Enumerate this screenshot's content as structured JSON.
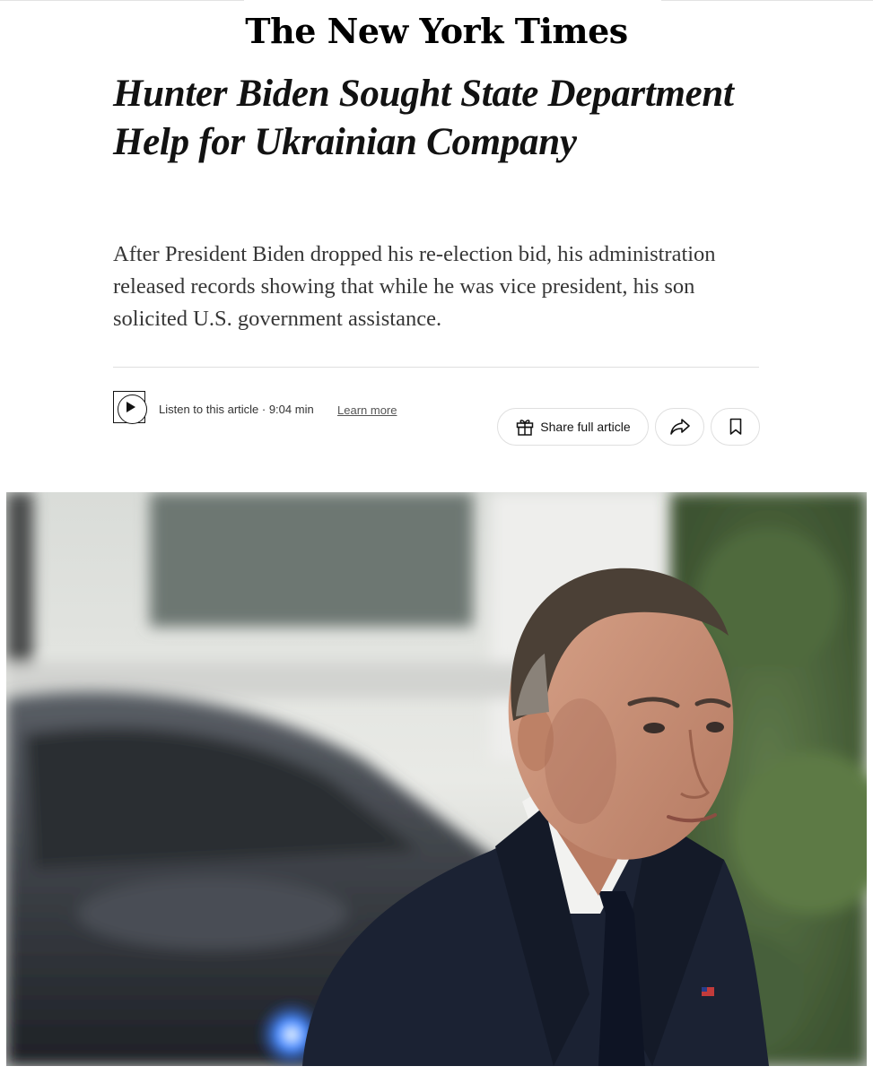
{
  "masthead": {
    "logo_text": "The New York Times"
  },
  "article": {
    "headline": "Hunter Biden Sought State Department Help for Ukrainian Company",
    "summary": "After President Biden dropped his re-election bid, his administration released records showing that while he was vice president, his son solicited U.S. government assistance."
  },
  "audio": {
    "label": "Listen to this article · 9:04 min",
    "learn_more": "Learn more",
    "icon": "play-icon"
  },
  "actions": {
    "share_full_label": "Share full article",
    "gift_icon": "gift-icon",
    "share_icon": "share-arrow-icon",
    "save_icon": "bookmark-icon"
  },
  "colors": {
    "text": "#121212",
    "summary_text": "#363636",
    "border": "#dfdfdf",
    "suit": "#1b2233"
  }
}
